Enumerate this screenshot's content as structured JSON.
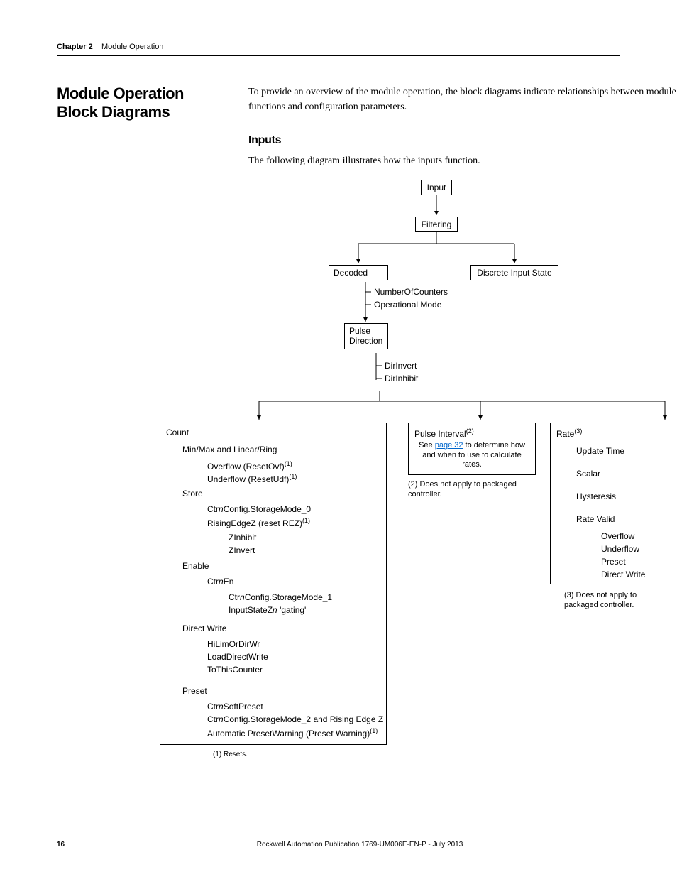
{
  "running_head": {
    "chapter": "Chapter 2",
    "title": "Module Operation"
  },
  "section_title": "Module Operation Block Diagrams",
  "intro": "To provide an overview of the module operation, the block diagrams indicate relationships between module functions and configuration parameters.",
  "subhead": "Inputs",
  "sub_intro": "The following diagram illustrates how the inputs function.",
  "diagram": {
    "input": "Input",
    "filtering": "Filtering",
    "decoded": "Decoded",
    "discrete": "Discrete Input State",
    "decoded_children": {
      "a": "NumberOfCounters",
      "b": "Operational Mode"
    },
    "pulse_dir": "Pulse\nDirection",
    "pulse_children": {
      "a": "DirInvert",
      "b": "DirInhibit"
    },
    "count": {
      "title": "Count",
      "minmax": "Min/Max and Linear/Ring",
      "overflow_pre": "Overflow (ResetOvf)",
      "underflow_pre": "Underflow (ResetUdf)",
      "store": "Store",
      "store_a_pre": "Ctr",
      "store_a_post": "Config.StorageMode_0",
      "store_b_pre": "RisingEdgeZ (reset REZ)",
      "zinhibit": "ZInhibit",
      "zinvert": "ZInvert",
      "enable": "Enable",
      "ctrn_en_pre": "Ctr",
      "ctrn_en_post": "En",
      "ctrn_sm1_pre": "Ctr",
      "ctrn_sm1_post": "Config.StorageMode_1",
      "inputstatez_pre": "InputStateZ",
      "inputstatez_post": " 'gating'",
      "directwrite": "Direct Write",
      "dw_a": "HiLimOrDirWr",
      "dw_b": "LoadDirectWrite",
      "dw_c": "ToThisCounter",
      "preset": "Preset",
      "preset_a_pre": "Ctr",
      "preset_a_post": "SoftPreset",
      "preset_b_pre": "Ctr",
      "preset_b_post": "Config.StorageMode_2 and Rising Edge Z",
      "preset_c_pre": "Automatic PresetWarning (Preset Warning)"
    },
    "pulse_interval": {
      "title_pre": "Pulse Interval",
      "see_pre": "See ",
      "see_link": "page 32",
      "see_post": " to determine how and when to use to calculate rates.",
      "note": "(2) Does not apply to packaged controller."
    },
    "rate": {
      "title_pre": "Rate",
      "a": "Update Time",
      "b": "Scalar",
      "c": "Hysteresis",
      "d": "Rate Valid",
      "d1": "Overflow",
      "d2": "Underflow",
      "d3": "Preset",
      "d4": "Direct Write",
      "note": "(3) Does not apply to packaged controller."
    },
    "footnote1": "(1) Resets.",
    "sup1": "(1)",
    "sup2": "(2)",
    "sup3": "(3)",
    "italic_n": "n"
  },
  "footer": {
    "page": "16",
    "publication": "Rockwell Automation Publication 1769-UM006E-EN-P - July 2013"
  }
}
